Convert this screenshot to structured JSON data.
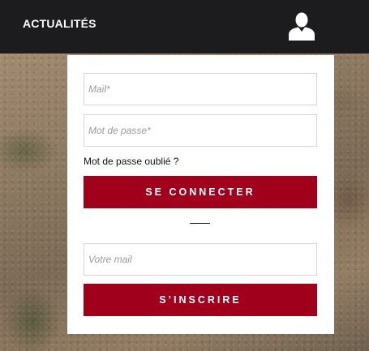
{
  "header": {
    "title": "ACTUALITÉS",
    "account_icon": "user-icon"
  },
  "login": {
    "email_placeholder": "Mail*",
    "password_placeholder": "Mot de passe*",
    "forgot_label": "Mot de passe oublié ?",
    "submit_label": "SE CONNECTER"
  },
  "newsletter": {
    "email_placeholder": "Votre mail",
    "submit_label": "S’INSCRIRE"
  },
  "colors": {
    "topbar": "#1c1b1d",
    "accent": "#a0001c"
  }
}
